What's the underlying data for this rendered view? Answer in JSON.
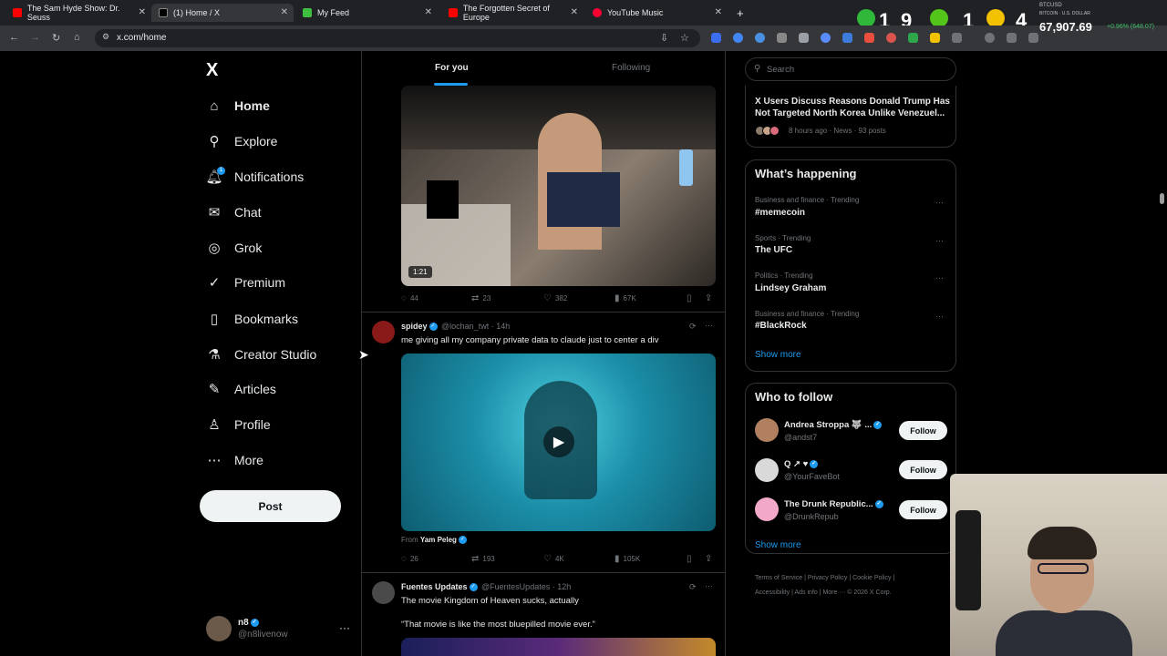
{
  "browser": {
    "tabs": [
      {
        "title": "The Sam Hyde Show: Dr. Seuss",
        "fav_color": "#ff0000"
      },
      {
        "title": "(1) Home / X",
        "fav_color": "#000000"
      },
      {
        "title": "My Feed",
        "fav_color": "#3fbf3f"
      },
      {
        "title": "The Forgotten Secret of Europe",
        "fav_color": "#ff0000"
      },
      {
        "title": "YouTube Music",
        "fav_color": "#ff0033"
      }
    ],
    "url": "x.com/home",
    "scores": [
      "1",
      "9",
      "1",
      "4"
    ],
    "btc_label": "BTCUSD",
    "btc_sub": "BITCOIN · U.S. DOLLAR",
    "btc_price": "67,907.69",
    "btc_change": "+0.96% (648.07)"
  },
  "nav": {
    "logo": "X",
    "items": [
      {
        "label": "Home",
        "icon": "home-icon"
      },
      {
        "label": "Explore",
        "icon": "search-icon"
      },
      {
        "label": "Notifications",
        "icon": "bell-icon"
      },
      {
        "label": "Chat",
        "icon": "mail-icon"
      },
      {
        "label": "Grok",
        "icon": "grok-icon"
      },
      {
        "label": "Premium",
        "icon": "verified-icon"
      },
      {
        "label": "Bookmarks",
        "icon": "bookmark-icon"
      },
      {
        "label": "Creator Studio",
        "icon": "flask-icon"
      },
      {
        "label": "Articles",
        "icon": "article-icon"
      },
      {
        "label": "Profile",
        "icon": "person-icon"
      },
      {
        "label": "More",
        "icon": "more-icon"
      }
    ],
    "notif_count": "1",
    "post_label": "Post",
    "user": {
      "name": "n8",
      "handle": "@n8livenow"
    }
  },
  "timeline": {
    "tab_for_you": "For you",
    "tab_following": "Following",
    "post1": {
      "duration": "1:21",
      "replies": "44",
      "reposts": "23",
      "likes": "382",
      "views": "67K"
    },
    "post2": {
      "name": "spidey",
      "handle": "@lochan_twt",
      "time": "· 14h",
      "text": "me giving all my company private data to claude just to center a div",
      "from_label": "From",
      "from_name": "Yam Peleg",
      "replies": "26",
      "reposts": "193",
      "likes": "4K",
      "views": "105K"
    },
    "post3": {
      "name": "Fuentes Updates",
      "handle": "@FuentesUpdates",
      "time": "· 12h",
      "text": "The movie Kingdom of Heaven sucks, actually",
      "quote": "“That movie is like the most bluepilled movie ever.”"
    }
  },
  "right": {
    "search_placeholder": "Search",
    "news_title": "X Users Discuss Reasons Donald Trump Has Not Targeted North Korea Unlike Venezuel...",
    "news_meta": "8 hours ago · News · 93 posts",
    "whats_happening": "What’s happening",
    "trends": [
      {
        "meta": "Business and finance · Trending",
        "name": "#memecoin"
      },
      {
        "meta": "Sports · Trending",
        "name": "The UFC"
      },
      {
        "meta": "Politics · Trending",
        "name": "Lindsey Graham"
      },
      {
        "meta": "Business and finance · Trending",
        "name": "#BlackRock"
      }
    ],
    "show_more": "Show more",
    "who_to_follow": "Who to follow",
    "follow": [
      {
        "name": "Andrea Stroppa 🐺 ...",
        "handle": "@andst7"
      },
      {
        "name": "Q ↗ ♥",
        "handle": "@YourFaveBot"
      },
      {
        "name": "The Drunk Republic...",
        "handle": "@DrunkRepub"
      }
    ],
    "follow_label": "Follow",
    "footer_line1": "Terms of Service  |  Privacy Policy  |  Cookie Policy  |",
    "footer_line2": "Accessibility  |  Ads info  |  More ···  © 2026 X Corp."
  }
}
